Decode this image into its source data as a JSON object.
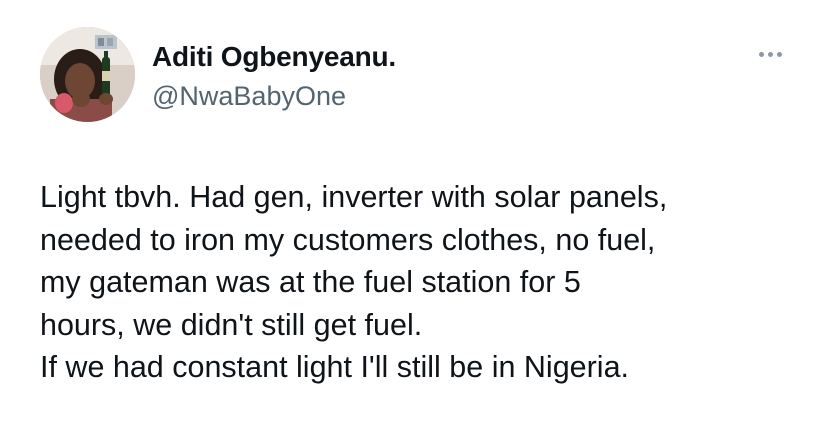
{
  "author": {
    "display_name": "Aditi Ogbenyeanu.",
    "handle": "@NwaBabyOne"
  },
  "menu": {
    "icon": "more-horizontal-icon"
  },
  "tweet": {
    "lines": [
      "Light tbvh. Had gen, inverter with solar panels,",
      "needed to iron my customers clothes, no fuel,",
      "my gateman was at the fuel station for 5",
      "hours, we didn't still get fuel.",
      "If we had constant light I'll still be in Nigeria."
    ]
  },
  "colors": {
    "text_primary": "#0f1419",
    "text_secondary": "#536471",
    "icon_muted": "#8b98a5",
    "background": "#ffffff"
  }
}
